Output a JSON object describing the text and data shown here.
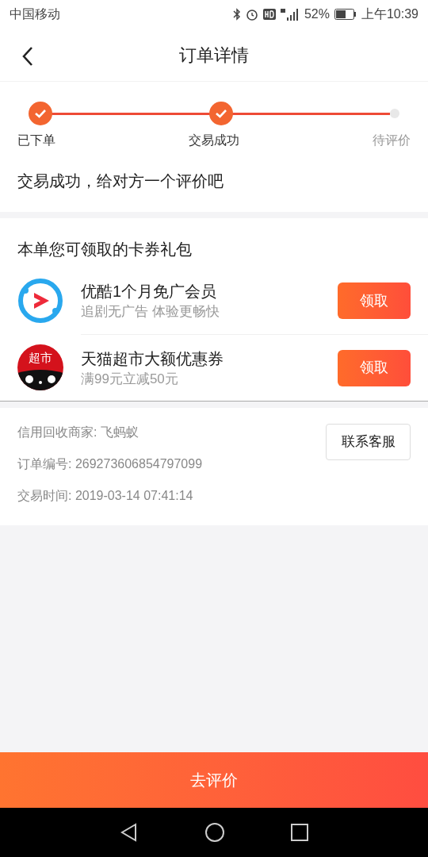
{
  "status_bar": {
    "carrier": "中国移动",
    "battery": "52%",
    "time": "上午10:39"
  },
  "header": {
    "title": "订单详情"
  },
  "steps": [
    {
      "label": "已下单",
      "done": true
    },
    {
      "label": "交易成功",
      "done": true
    },
    {
      "label": "待评价",
      "done": false
    }
  ],
  "message": "交易成功，给对方一个评价吧",
  "coupons": {
    "title": "本单您可领取的卡券礼包",
    "items": [
      {
        "kind": "video",
        "name": "优酷1个月免广会员",
        "desc": "追剧无广告 体验更畅快",
        "button": "领取"
      },
      {
        "kind": "market",
        "logo_text": "超市",
        "name": "天猫超市大额优惠券",
        "desc": "满99元立减50元",
        "button": "领取"
      }
    ]
  },
  "info": {
    "rows": [
      "信用回收商家: 飞蚂蚁",
      "订单编号: 269273606854797099",
      "交易时间: 2019-03-14 07:41:14"
    ],
    "contact_button": "联系客服"
  },
  "bottom_button": "去评价"
}
